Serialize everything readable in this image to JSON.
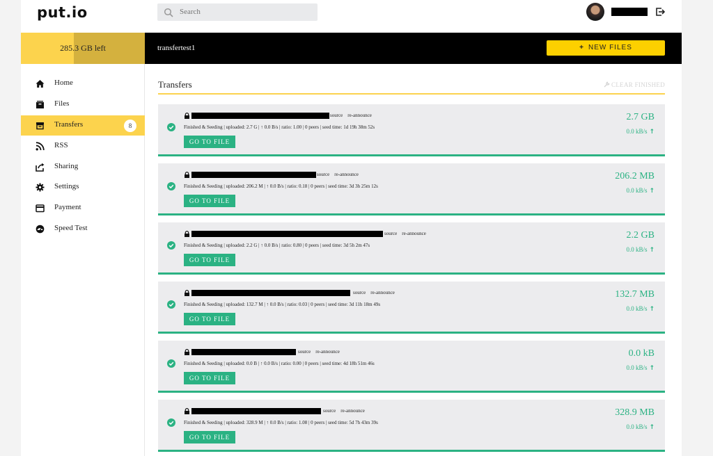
{
  "app": {
    "logo": "PUT.io",
    "search": {
      "placeholder": "Search"
    },
    "space": {
      "label": "285.3 GB left",
      "used_fraction": 0.43
    },
    "account": {
      "username": "transfertest1"
    },
    "new_files_label": "NEW FILES"
  },
  "sidebar": {
    "items": [
      {
        "label": "Home",
        "icon": "home-icon"
      },
      {
        "label": "Files",
        "icon": "files-icon"
      },
      {
        "label": "Transfers",
        "icon": "transfers-icon",
        "count": "8",
        "active": true
      },
      {
        "label": "RSS",
        "icon": "rss-icon"
      },
      {
        "label": "Sharing",
        "icon": "sharing-icon"
      },
      {
        "label": "Settings",
        "icon": "gear-icon"
      },
      {
        "label": "Payment",
        "icon": "payment-icon"
      },
      {
        "label": "Speed Test",
        "icon": "speedometer-icon"
      }
    ]
  },
  "transfers": {
    "heading": "Transfers",
    "clear_label": "CLEAR FINISHED",
    "source_label": "source",
    "reannounce_label": "re-announce",
    "goto_label": "GO TO FILE",
    "items": [
      {
        "status": "Finished & Seeding | uploaded: 2.7 G | ↑ 0.0 B/s | ratio: 1.00 | 0 peers | seed time: 1d 19h 38m 52s",
        "size": "2.7 GB",
        "speed": "0.0 kB/s"
      },
      {
        "status": "Finished & Seeding | uploaded: 206.2 M | ↑ 0.0 B/s | ratio: 0.18 | 0 peers | seed time: 3d 3h 25m 12s",
        "size": "206.2 MB",
        "speed": "0.0 kB/s"
      },
      {
        "status": "Finished & Seeding | uploaded: 2.2 G | ↑ 0.0 B/s | ratio: 0.80 | 0 peers | seed time: 3d 5h 2m 47s",
        "size": "2.2 GB",
        "speed": "0.0 kB/s"
      },
      {
        "status": "Finished & Seeding | uploaded: 132.7 M | ↑ 0.0 B/s | ratio: 0.03 | 0 peers | seed time: 3d 11h 18m 49s",
        "size": "132.7 MB",
        "speed": "0.0 kB/s"
      },
      {
        "status": "Finished & Seeding | uploaded: 0.0 B | ↑ 0.0 B/s | ratio: 0.00 | 0 peers | seed time: 4d 18h 51m 46s",
        "size": "0.0 kB",
        "speed": "0.0 kB/s"
      },
      {
        "status": "Finished & Seeding | uploaded: 328.9 M | ↑ 0.0 B/s | ratio: 1.08 | 0 peers | seed time: 5d 7h 43m 39s",
        "size": "328.9 MB",
        "speed": "0.0 kB/s"
      }
    ]
  },
  "colors": {
    "accent": "#fcd34d",
    "success": "#2bb283",
    "dark": "#000000"
  }
}
